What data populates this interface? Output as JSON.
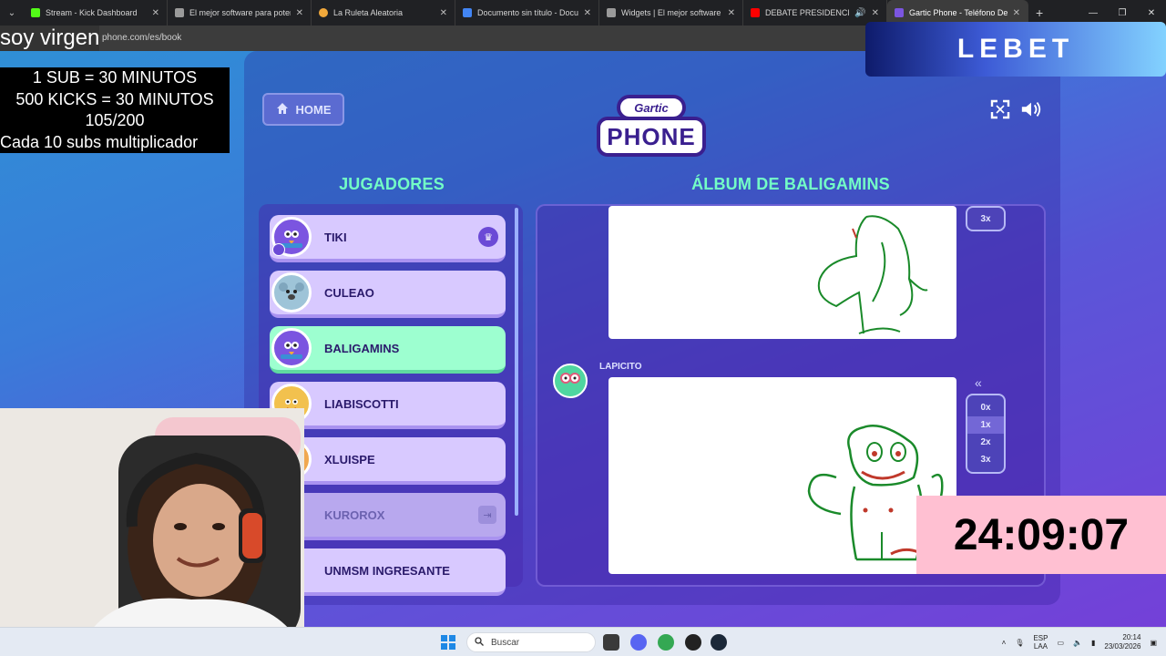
{
  "browser": {
    "tabs": [
      {
        "label": "Stream - Kick Dashboard",
        "color": "#53fc18"
      },
      {
        "label": "El mejor software para potencia",
        "color": "#9a9a9a"
      },
      {
        "label": "La Ruleta Aleatoria",
        "color": "#f2a93b"
      },
      {
        "label": "Documento sin título - Docume",
        "color": "#4285f4"
      },
      {
        "label": "Widgets | El mejor software pa",
        "color": "#9a9a9a"
      },
      {
        "label": "DEBATE PRESIDENCIAL",
        "color": "#ff0000"
      },
      {
        "label": "Gartic Phone - Teléfono Desco",
        "color": "#7b55e0"
      }
    ],
    "url": "phone.com/es/book"
  },
  "game": {
    "home_label": "HOME",
    "logo_top": "Gartic",
    "logo_bottom": "PHONE",
    "players_title": "JUGADORES",
    "album_title": "ÁLBUM DE BALIGAMINS",
    "players": [
      {
        "name": "TIKI",
        "avatar_color": "#7b55e0",
        "state": "host"
      },
      {
        "name": "CULEAO",
        "avatar_color": "#9ec4d8",
        "state": "normal"
      },
      {
        "name": "BALIGAMINS",
        "avatar_color": "#7b55e0",
        "state": "highlight"
      },
      {
        "name": "LIABISCOTTI",
        "avatar_color": "#f2c14e",
        "state": "normal"
      },
      {
        "name": "XLUISPE",
        "avatar_color": "#f0a850",
        "state": "normal"
      },
      {
        "name": "KUROROX",
        "avatar_color": "#b8a8ee",
        "state": "left"
      },
      {
        "name": "UNMSM INGRESANTE",
        "avatar_color": "#b8a8ee",
        "state": "normal"
      }
    ],
    "album_author": "LAPICITO",
    "speed_top": [
      "3x"
    ],
    "speed_options": [
      "0x",
      "1x",
      "2x",
      "3x"
    ],
    "speed_selected": "1x"
  },
  "overlay": {
    "title": "soy virgen",
    "rules": [
      "1 SUB     = 30 MINUTOS",
      "500 KICKS = 30 MINUTOS",
      "105/200",
      "Cada 10 subs multiplicador"
    ],
    "sponsor": "LEBET",
    "timer": "24:09:07"
  },
  "taskbar": {
    "search_placeholder": "Buscar",
    "lang_top": "ESP",
    "lang_bottom": "LAA",
    "time": "20:14",
    "date": "23/03/2026"
  }
}
